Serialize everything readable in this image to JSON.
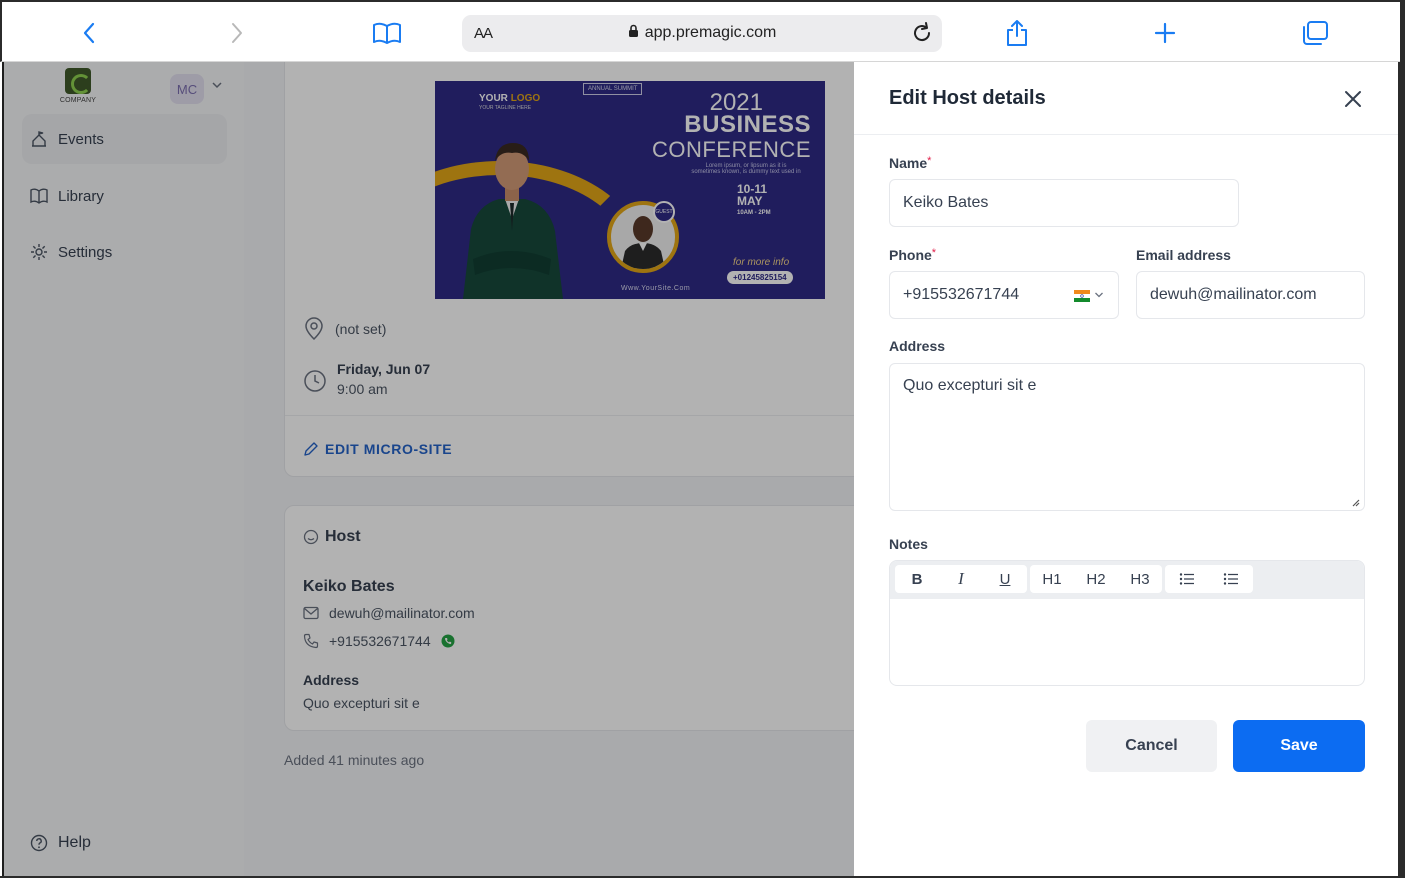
{
  "browser": {
    "aa_label": "AA",
    "url": "app.premagic.com"
  },
  "sidebar": {
    "logo_text": "COMPANY",
    "avatar_initials": "MC",
    "items": [
      {
        "label": "Events"
      },
      {
        "label": "Library"
      },
      {
        "label": "Settings"
      }
    ],
    "help_label": "Help"
  },
  "event": {
    "banner": {
      "logo": "YOUR",
      "logo_accent": "LOGO",
      "tagline": "YOUR TAGLINE HERE",
      "annual": "ANNUAL SUMMIT",
      "year": "2021",
      "title1": "BUSINESS",
      "title2": "CONFERENCE",
      "small": "Lorem ipsum, or lipsum as it is sometimes known, is dummy text used in",
      "date_days": "10-11",
      "date_month": "MAY",
      "date_time": "10AM - 2PM",
      "guest": "GUEST",
      "more_info": "for more info",
      "phone": "+01245825154",
      "site": "Www.YourSite.Com"
    },
    "location": "(not set)",
    "date": "Friday, Jun 07",
    "time": "9:00 am",
    "edit_link": "EDIT MICRO-SITE"
  },
  "host_card": {
    "title": "Host",
    "name": "Keiko Bates",
    "email": "dewuh@mailinator.com",
    "phone": "+915532671744",
    "address_label": "Address",
    "address": "Quo excepturi sit e",
    "added": "Added 41 minutes ago"
  },
  "drawer": {
    "title": "Edit Host details",
    "name_label": "Name",
    "name_value": "Keiko Bates",
    "phone_label": "Phone",
    "phone_value": "+915532671744",
    "email_label": "Email address",
    "email_value": "dewuh@mailinator.com",
    "address_label": "Address",
    "address_value": "Quo excepturi sit e",
    "notes_label": "Notes",
    "toolbar": {
      "bold": "B",
      "italic": "I",
      "underline": "U",
      "h1": "H1",
      "h2": "H2",
      "h3": "H3"
    },
    "cancel_label": "Cancel",
    "save_label": "Save"
  },
  "colors": {
    "primary": "#0c6cf2",
    "link": "#2563c9",
    "required": "#e11d48",
    "whatsapp": "#25a244"
  }
}
